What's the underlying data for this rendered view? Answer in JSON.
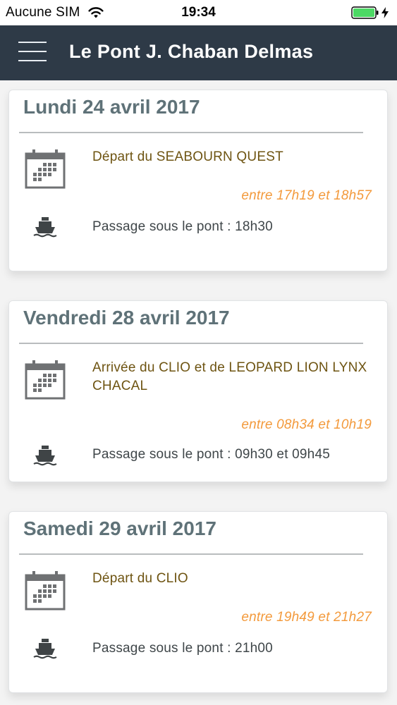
{
  "status_bar": {
    "carrier": "Aucune SIM",
    "time": "19:34",
    "battery_color": "#4cd964",
    "wifi_icon": "wifi-icon",
    "charge_icon": "lightning-icon"
  },
  "nav_bar": {
    "title": "Le Pont J. Chaban Delmas",
    "menu_icon": "hamburger-menu-icon",
    "background_color": "#2e3a47"
  },
  "colors": {
    "date_heading": "#5f7278",
    "event_title": "#6e5412",
    "event_time": "#f39a3c",
    "passage_text": "#3f4649"
  },
  "events": [
    {
      "date": "Lundi 24 avril 2017",
      "title": "Départ du SEABOURN QUEST",
      "time_range": "entre 17h19 et 18h57",
      "passage": "Passage sous le pont : 18h30",
      "calendar_icon": "calendar-icon",
      "ship_icon": "ship-icon"
    },
    {
      "date": "Vendredi 28 avril 2017",
      "title": "Arrivée du CLIO et de LEOPARD LION LYNX CHACAL",
      "time_range": "entre 08h34 et 10h19",
      "passage": "Passage sous le pont : 09h30 et 09h45",
      "calendar_icon": "calendar-icon",
      "ship_icon": "ship-icon"
    },
    {
      "date": "Samedi 29 avril 2017",
      "title": "Départ du CLIO",
      "time_range": "entre 19h49 et 21h27",
      "passage": "Passage sous le pont : 21h00",
      "calendar_icon": "calendar-icon",
      "ship_icon": "ship-icon"
    }
  ]
}
